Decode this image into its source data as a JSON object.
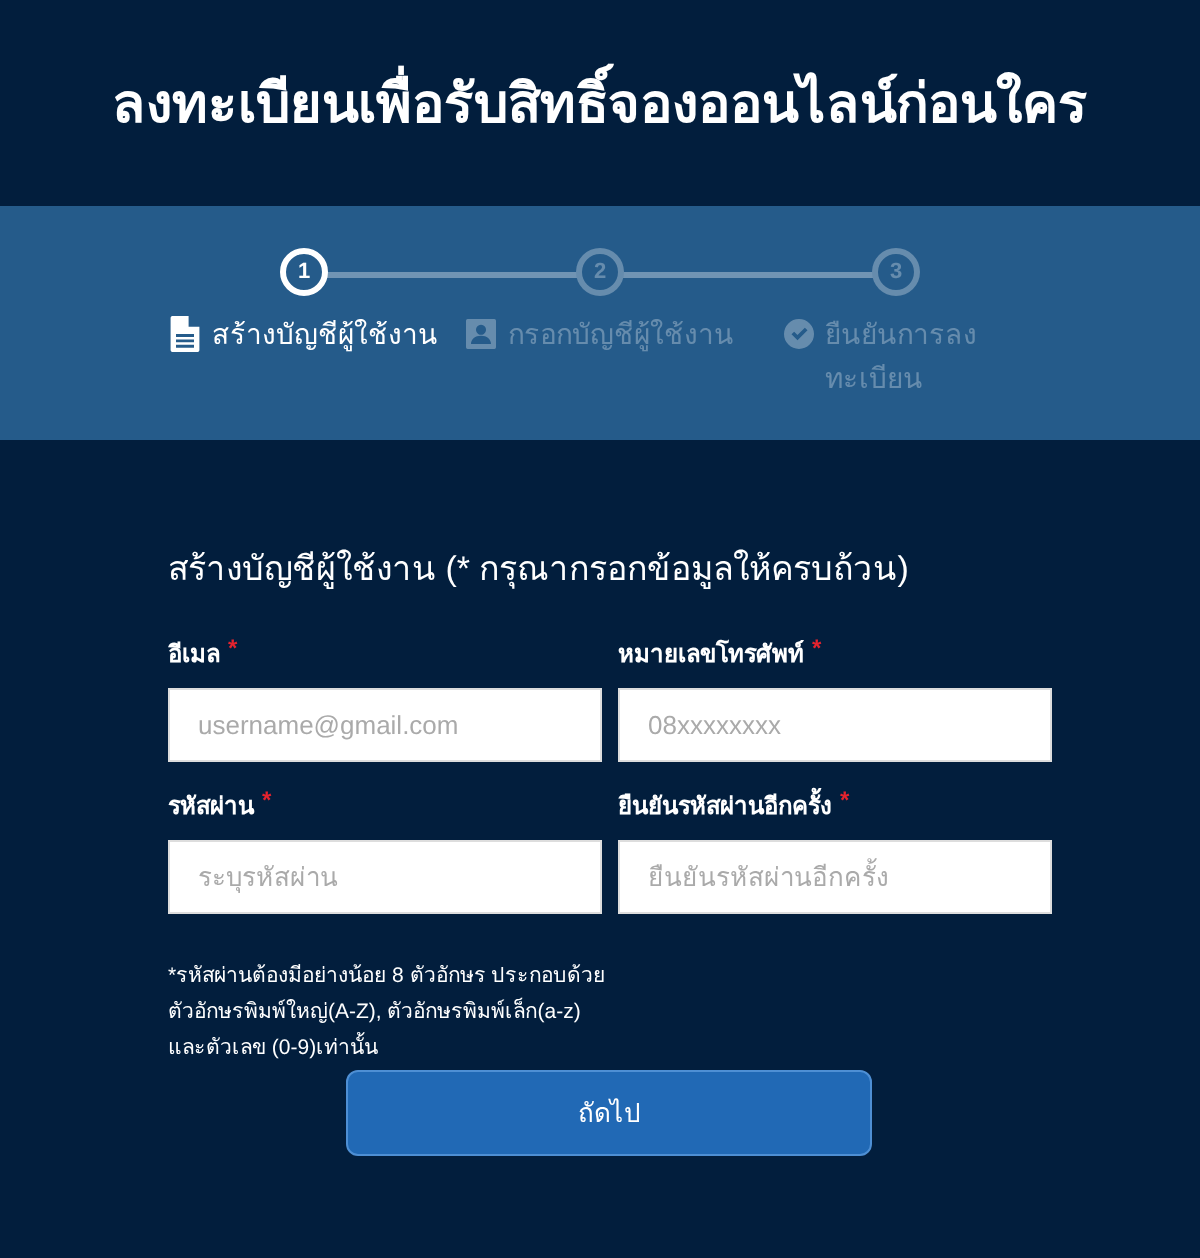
{
  "header": {
    "title": "ลงทะเบียนเพื่อรับสิทธิ์จองออนไลน์ก่อนใคร"
  },
  "steps": [
    {
      "number": "1",
      "label": "สร้างบัญชีผู้ใช้งาน",
      "kind": "document",
      "selected": true
    },
    {
      "number": "2",
      "label": "กรอกบัญชีผู้ใช้งาน",
      "kind": "person",
      "selected": false
    },
    {
      "number": "3",
      "label": "ยืนยันการลงทะเบียน",
      "kind": "check",
      "selected": false
    }
  ],
  "form": {
    "heading": "สร้างบัญชีผู้ใช้งาน (* กรุณากรอกข้อมูลให้ครบถ้วน)",
    "fields": [
      {
        "label": "อีเมล",
        "required": true,
        "placeholder": "username@gmail.com"
      },
      {
        "label": "หมายเลขโทรศัพท์",
        "required": true,
        "placeholder": "08xxxxxxxx"
      },
      {
        "label": "รหัสผ่าน",
        "required": true,
        "placeholder": "ระบุรหัสผ่าน"
      },
      {
        "label": "ยืนยันรหัสผ่านอีกครั้ง",
        "required": true,
        "placeholder": "ยืนยันรหัสผ่านอีกครั้ง"
      }
    ],
    "required_mark": "*",
    "note": "*รหัสผ่านต้องมีอย่างน้อย 8 ตัวอักษร ประกอบด้วยตัวอักษรพิมพ์ใหญ่(A-Z), ตัวอักษรพิมพ์เล็ก(a-z) และตัวเลข (0-9)เท่านั้น",
    "submit": "ถัดไป"
  }
}
